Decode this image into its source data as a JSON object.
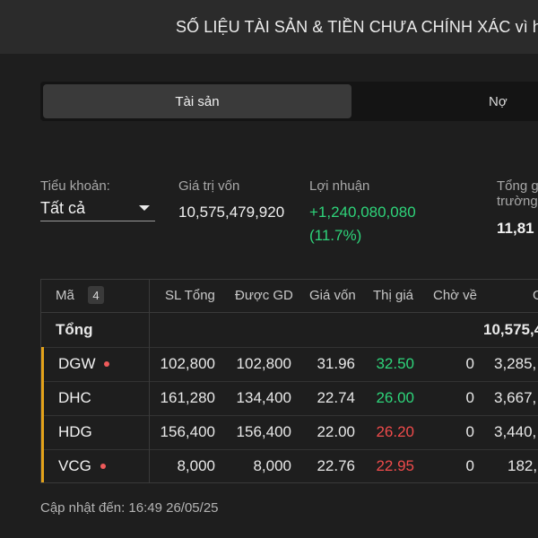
{
  "banner": {
    "text": "SỐ LIỆU TÀI SẢN & TIỀN CHƯA CHÍNH XÁC vì hệ",
    "icon": "warning-icon",
    "icon_color": "#f5a623"
  },
  "tabs": [
    {
      "label": "Tài sản",
      "active": true
    },
    {
      "label": "Nợ",
      "active": false
    }
  ],
  "summary": {
    "subaccount_label": "Tiểu khoản:",
    "subaccount_value": "Tất cả",
    "cost_label": "Giá trị vốn",
    "cost_value": "10,575,479,920",
    "profit_label": "Lợi nhuận",
    "profit_value": "+1,240,080,080",
    "profit_pct": "(11.7%)",
    "market_label_1": "Tổng g",
    "market_label_2": "trường",
    "market_value": "11,81"
  },
  "table": {
    "headers": {
      "symbol": "Mã",
      "count": "4",
      "qty": "SL Tổng",
      "tradable": "Được GD",
      "cost": "Giá vốn",
      "market": "Thị giá",
      "pending": "Chờ về",
      "value": "G"
    },
    "total": {
      "label": "Tổng",
      "value": "10,575,4"
    },
    "rows": [
      {
        "symbol": "DGW",
        "dot": true,
        "qty": "102,800",
        "tradable": "102,800",
        "cost": "31.96",
        "market": "32.50",
        "market_color": "green",
        "pending": "0",
        "value": "3,285,"
      },
      {
        "symbol": "DHC",
        "dot": false,
        "qty": "161,280",
        "tradable": "134,400",
        "cost": "22.74",
        "market": "26.00",
        "market_color": "green",
        "pending": "0",
        "value": "3,667,"
      },
      {
        "symbol": "HDG",
        "dot": false,
        "qty": "156,400",
        "tradable": "156,400",
        "cost": "22.00",
        "market": "26.20",
        "market_color": "red",
        "pending": "0",
        "value": "3,440,"
      },
      {
        "symbol": "VCG",
        "dot": true,
        "qty": "8,000",
        "tradable": "8,000",
        "cost": "22.76",
        "market": "22.95",
        "market_color": "red",
        "pending": "0",
        "value": "182,"
      }
    ]
  },
  "footer": {
    "updated": "Cập nhật đến: 16:49 26/05/25"
  },
  "colors": {
    "accent": "#e3a21a",
    "up": "#2ed47a",
    "down": "#ef4b4b",
    "dot": "#ef5a5a"
  }
}
